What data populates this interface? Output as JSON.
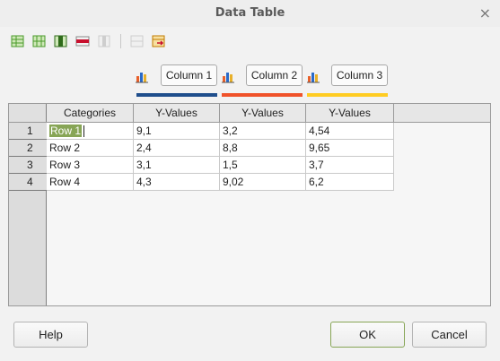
{
  "window": {
    "title": "Data Table",
    "close_glyph": "×"
  },
  "toolbar": {
    "items": [
      {
        "name": "insert-row-icon",
        "color": "#4a9a2a"
      },
      {
        "name": "insert-series-icon",
        "color": "#4a9a2a"
      },
      {
        "name": "insert-text-column-icon",
        "color": "#4a9a2a"
      },
      {
        "name": "delete-row-icon",
        "color": "#c8102e"
      },
      {
        "name": "delete-series-icon",
        "color": "#999999"
      },
      {
        "name": "move-row-down-icon",
        "color": "#999999"
      },
      {
        "name": "move-column-right-icon",
        "color": "#c8102e"
      }
    ]
  },
  "series": [
    {
      "name": "Column 1",
      "color": "#1f4e8c"
    },
    {
      "name": "Column 2",
      "color": "#f0522a"
    },
    {
      "name": "Column 3",
      "color": "#ffcc22"
    }
  ],
  "table": {
    "headers": [
      "Categories",
      "Y-Values",
      "Y-Values",
      "Y-Values"
    ],
    "rows": [
      {
        "num": "1",
        "cells": [
          "Row 1",
          "9,1",
          "3,2",
          "4,54"
        ]
      },
      {
        "num": "2",
        "cells": [
          "Row 2",
          "2,4",
          "8,8",
          "9,65"
        ]
      },
      {
        "num": "3",
        "cells": [
          "Row 3",
          "3,1",
          "1,5",
          "3,7"
        ]
      },
      {
        "num": "4",
        "cells": [
          "Row 4",
          "4,3",
          "9,02",
          "6,2"
        ]
      }
    ]
  },
  "buttons": {
    "help": "Help",
    "ok": "OK",
    "cancel": "Cancel"
  }
}
